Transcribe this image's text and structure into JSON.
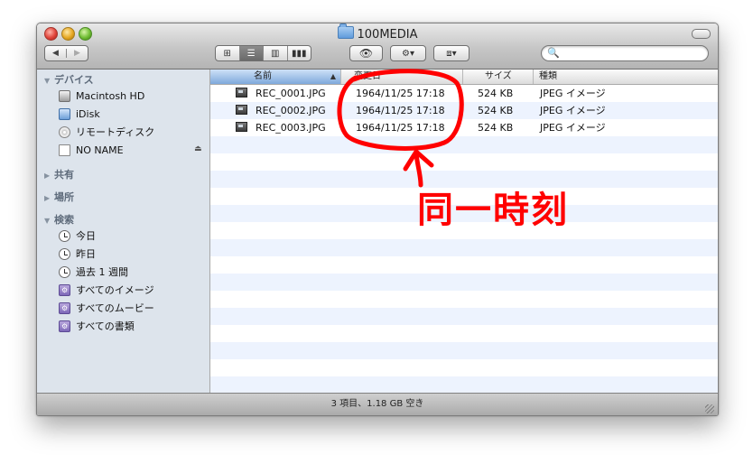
{
  "window": {
    "title": "100MEDIA",
    "status": "3 項目、1.18 GB 空き"
  },
  "toolbar": {
    "back_label": "◀",
    "forward_label": "▶",
    "views": [
      "⊞",
      "☰",
      "▥",
      "▮▮▮"
    ],
    "active_view": 1,
    "quicklook_label": "👁",
    "action_label": "⚙▾",
    "dropbox_label": "⧈▾",
    "search_placeholder": ""
  },
  "sidebar": {
    "devices_header": "デバイス",
    "devices": [
      {
        "label": "Macintosh HD",
        "icon": "hard-drive-icon"
      },
      {
        "label": "iDisk",
        "icon": "idisk-icon"
      },
      {
        "label": "リモートディスク",
        "icon": "remote-disc-icon"
      },
      {
        "label": "NO NAME",
        "icon": "external-drive-icon"
      }
    ],
    "shared_header": "共有",
    "places_header": "場所",
    "search_header": "検索",
    "searches": [
      {
        "label": "今日",
        "icon": "clock-icon"
      },
      {
        "label": "昨日",
        "icon": "clock-icon"
      },
      {
        "label": "過去 1 週間",
        "icon": "clock-icon"
      },
      {
        "label": "すべてのイメージ",
        "icon": "smart-folder-icon"
      },
      {
        "label": "すべてのムービー",
        "icon": "smart-folder-icon"
      },
      {
        "label": "すべての書類",
        "icon": "smart-folder-icon"
      }
    ]
  },
  "columns": {
    "name": "名前",
    "modified": "変更日",
    "size": "サイズ",
    "kind": "種類"
  },
  "files": [
    {
      "name": "REC_0001.JPG",
      "modified": "1964/11/25 17:18",
      "size": "524 KB",
      "kind": "JPEG イメージ"
    },
    {
      "name": "REC_0002.JPG",
      "modified": "1964/11/25 17:18",
      "size": "524 KB",
      "kind": "JPEG イメージ"
    },
    {
      "name": "REC_0003.JPG",
      "modified": "1964/11/25 17:18",
      "size": "524 KB",
      "kind": "JPEG イメージ"
    }
  ],
  "annotation": {
    "text": "同一時刻",
    "color": "#ff0000"
  }
}
